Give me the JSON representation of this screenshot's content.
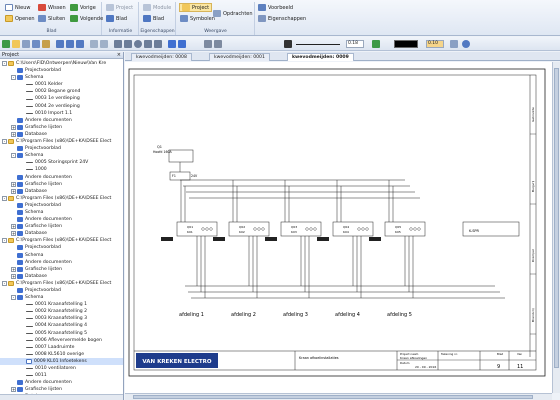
{
  "ribbon": {
    "blad": {
      "label": "Blad",
      "nieuw": "Nieuw",
      "wissen": "Wissen",
      "vorige": "Vorige",
      "openen": "Openen",
      "sluiten": "Sluiten",
      "volgende": "Volgende"
    },
    "informatie": {
      "label": "Informatie",
      "project": "Project",
      "blad": "Blad"
    },
    "eigenschappen": {
      "label": "Eigenschappen",
      "module": "Module",
      "blad": "Blad"
    },
    "weergave": {
      "label": "Weergave",
      "project": "Project",
      "symbolen": "Symbolen",
      "opdrachten": "Opdrachten"
    },
    "extra": {
      "voorbeeld": "Voorbeeld",
      "eigenschappen": "Eigenschappen"
    }
  },
  "toolbar": {
    "line_width": "0.18",
    "thickness": "0.10"
  },
  "panel": {
    "title": "Project",
    "tree": [
      {
        "level": 0,
        "pm": "-",
        "icon": "folder",
        "label": "C:\\Users\\FID\\Ontwerpen\\Nieuw\\Van Kre"
      },
      {
        "level": 1,
        "pm": "",
        "icon": "blue",
        "label": "Projectvoorblad"
      },
      {
        "level": 1,
        "pm": "-",
        "icon": "blue",
        "label": "Schema"
      },
      {
        "level": 2,
        "pm": "",
        "icon": "line",
        "label": "0001 Kelder"
      },
      {
        "level": 2,
        "pm": "",
        "icon": "line",
        "label": "0002 Begane grond"
      },
      {
        "level": 2,
        "pm": "",
        "icon": "line",
        "label": "0003 1e verdieping"
      },
      {
        "level": 2,
        "pm": "",
        "icon": "line",
        "label": "0004 2e verdieping"
      },
      {
        "level": 2,
        "pm": "",
        "icon": "line",
        "label": "0010 Import 1.1"
      },
      {
        "level": 1,
        "pm": "",
        "icon": "blue",
        "label": "Andere documenten"
      },
      {
        "level": 1,
        "pm": "+",
        "icon": "blue",
        "label": "Grafische lijsten"
      },
      {
        "level": 1,
        "pm": "+",
        "icon": "blue",
        "label": "Database"
      },
      {
        "level": 0,
        "pm": "-",
        "icon": "folder",
        "label": "C:\\Program Files (x86)\\DE+KA\\DSEE Elect"
      },
      {
        "level": 1,
        "pm": "",
        "icon": "blue",
        "label": "Projectvoorblad"
      },
      {
        "level": 1,
        "pm": "-",
        "icon": "blue",
        "label": "Schema"
      },
      {
        "level": 2,
        "pm": "",
        "icon": "line",
        "label": "0005 Storingsprint 24V"
      },
      {
        "level": 2,
        "pm": "",
        "icon": "line",
        "label": "1000"
      },
      {
        "level": 1,
        "pm": "",
        "icon": "blue",
        "label": "Andere documenten"
      },
      {
        "level": 1,
        "pm": "+",
        "icon": "blue",
        "label": "Grafische lijsten"
      },
      {
        "level": 1,
        "pm": "+",
        "icon": "blue",
        "label": "Database"
      },
      {
        "level": 0,
        "pm": "-",
        "icon": "folder",
        "label": "C:\\Program Files (x86)\\DE+KA\\DSEE Elect"
      },
      {
        "level": 1,
        "pm": "",
        "icon": "blue",
        "label": "Projectvoorblad"
      },
      {
        "level": 1,
        "pm": "",
        "icon": "blue",
        "label": "Schema"
      },
      {
        "level": 1,
        "pm": "",
        "icon": "blue",
        "label": "Andere documenten"
      },
      {
        "level": 1,
        "pm": "+",
        "icon": "blue",
        "label": "Grafische lijsten"
      },
      {
        "level": 1,
        "pm": "+",
        "icon": "blue",
        "label": "Database"
      },
      {
        "level": 0,
        "pm": "-",
        "icon": "folder",
        "label": "C:\\Program Files (x86)\\DE+KA\\DSEE Elect"
      },
      {
        "level": 1,
        "pm": "",
        "icon": "blue",
        "label": "Projectvoorblad"
      },
      {
        "level": 1,
        "pm": "",
        "icon": "blue",
        "label": "Schema"
      },
      {
        "level": 1,
        "pm": "",
        "icon": "blue",
        "label": "Andere documenten"
      },
      {
        "level": 1,
        "pm": "+",
        "icon": "blue",
        "label": "Grafische lijsten"
      },
      {
        "level": 1,
        "pm": "+",
        "icon": "blue",
        "label": "Database"
      },
      {
        "level": 0,
        "pm": "-",
        "icon": "folder",
        "label": "C:\\Program Files (x86)\\DE+KA\\DSEE Elect"
      },
      {
        "level": 1,
        "pm": "",
        "icon": "blue",
        "label": "Projectvoorblad"
      },
      {
        "level": 1,
        "pm": "-",
        "icon": "blue",
        "label": "Schema"
      },
      {
        "level": 2,
        "pm": "",
        "icon": "line",
        "label": "0001 Kraanafstelling 1"
      },
      {
        "level": 2,
        "pm": "",
        "icon": "line",
        "label": "0002 Kraanafstelling 2"
      },
      {
        "level": 2,
        "pm": "",
        "icon": "line",
        "label": "0003 Kraanafstelling 3"
      },
      {
        "level": 2,
        "pm": "",
        "icon": "line",
        "label": "0004 Kraanafstelling 4"
      },
      {
        "level": 2,
        "pm": "",
        "icon": "line",
        "label": "0005 Kraanafstelling 5"
      },
      {
        "level": 2,
        "pm": "",
        "icon": "line",
        "label": "0006 Afleververmelde bogen"
      },
      {
        "level": 2,
        "pm": "",
        "icon": "line",
        "label": "0007 Laadruimte"
      },
      {
        "level": 2,
        "pm": "",
        "icon": "line",
        "label": "0008 KL5610 overige"
      },
      {
        "level": 2,
        "pm": "",
        "icon": "sheet",
        "label": "0009 KL01 Infoetekens",
        "selected": true
      },
      {
        "level": 2,
        "pm": "",
        "icon": "line",
        "label": "0010 ventilatoren"
      },
      {
        "level": 2,
        "pm": "",
        "icon": "line",
        "label": "0011"
      },
      {
        "level": 1,
        "pm": "",
        "icon": "blue",
        "label": "Andere documenten"
      },
      {
        "level": 1,
        "pm": "+",
        "icon": "blue",
        "label": "Grafische lijsten"
      },
      {
        "level": 1,
        "pm": "+",
        "icon": "blue",
        "label": "Database"
      }
    ]
  },
  "tabs": [
    {
      "label": "kwevodmeijden: 0008",
      "active": false
    },
    {
      "label": "kwevodmeijden: 0001",
      "active": false
    },
    {
      "label": "kwevodmeijden: 0009",
      "active": true
    }
  ],
  "drawing": {
    "main_switch": {
      "tag": "Q1",
      "label": "Hoofd 160A"
    },
    "relay": {
      "tag": "F1",
      "label": "24V"
    },
    "groups": [
      {
        "tag": "Q01",
        "device": "K01",
        "label": "afdeling  1"
      },
      {
        "tag": "Q02",
        "device": "K02",
        "label": "afdeling  2"
      },
      {
        "tag": "Q03",
        "device": "K03",
        "label": "afdeling  3"
      },
      {
        "tag": "Q04",
        "device": "K04",
        "label": "afdeling  4"
      },
      {
        "tag": "Q05",
        "device": "K05",
        "label": "afdeling  5"
      }
    ],
    "spare": "K-SPR",
    "right_labels": [
      "Gebruikte",
      "Buigvrij",
      "Drempel",
      "Brandvrij"
    ],
    "title_block": {
      "logo": "VAN KREKEN ELECTRO",
      "description": "Kraan afkoelinstallaties",
      "project_label": "Project naam",
      "project_value": "Kraan afkoelingen",
      "tekening_label": "Tekening nr.",
      "datum_label": "Datum",
      "datum_value": "20 - 09 - 2016",
      "blad_label": "Blad",
      "blad_value": "9",
      "van_label": "Van",
      "van_value": "11"
    }
  }
}
